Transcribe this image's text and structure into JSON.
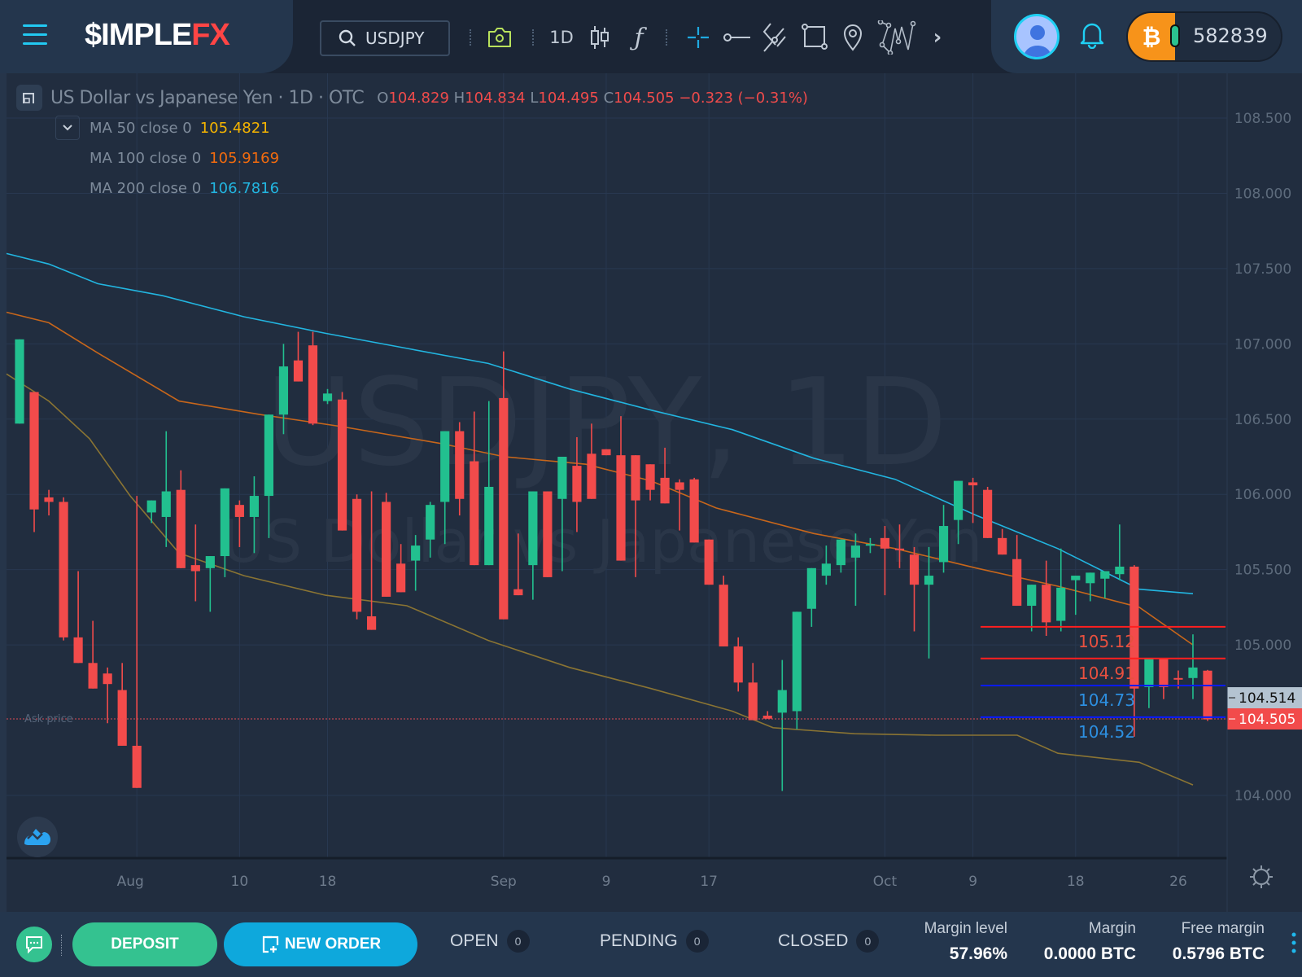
{
  "topbar": {
    "logo_prefix": "$IMPLE",
    "logo_suffix": "FX",
    "search_value": "USDJPY",
    "timeframe": "1D",
    "icons": [
      "menu-icon",
      "search-icon",
      "camera-icon",
      "candles-icon",
      "function-icon",
      "crosshair-icon",
      "horizontal-line-icon",
      "trend-lines-icon",
      "rectangle-icon",
      "location-pin-icon",
      "pattern-icon",
      "chevron-right-icon"
    ],
    "balance": "582839",
    "currency": "BTC"
  },
  "legend": {
    "title": "US Dollar vs Japanese Yen · 1D · OTC",
    "o_label": "O",
    "o": "104.829",
    "h_label": "H",
    "h": "104.834",
    "l_label": "L",
    "l": "104.495",
    "c_label": "C",
    "c": "104.505",
    "change": "−0.323 (−0.31%)",
    "ma": [
      {
        "label": "MA 50 close 0",
        "value": "105.4821",
        "color": "#f5b400"
      },
      {
        "label": "MA 100 close 0",
        "value": "105.9169",
        "color": "#f26b0e"
      },
      {
        "label": "MA 200 close 0",
        "value": "106.7816",
        "color": "#22b5e0"
      }
    ]
  },
  "watermark": {
    "symbol": "USDJPY, 1D",
    "name": "US Dollar vs Japanese Yen"
  },
  "chart_data": {
    "type": "candlestick",
    "title": "US Dollar vs Japanese Yen · 1D · OTC",
    "ylim": [
      103.6,
      108.72
    ],
    "y_ticks": [
      "108.500",
      "108.000",
      "107.500",
      "107.000",
      "106.500",
      "106.000",
      "105.500",
      "105.000",
      "104.000"
    ],
    "y_tick_values": [
      108.5,
      108.0,
      107.5,
      107.0,
      106.5,
      106.0,
      105.5,
      105.0,
      104.0
    ],
    "x_ticks": [
      {
        "label": "Aug",
        "index": 8
      },
      {
        "label": "10",
        "index": 15
      },
      {
        "label": "18",
        "index": 21
      },
      {
        "label": "Sep",
        "index": 33
      },
      {
        "label": "9",
        "index": 40
      },
      {
        "label": "17",
        "index": 47
      },
      {
        "label": "Oct",
        "index": 59
      },
      {
        "label": "9",
        "index": 65
      },
      {
        "label": "18",
        "index": 72
      },
      {
        "label": "26",
        "index": 79
      }
    ],
    "candles": [
      [
        106.47,
        107.03,
        106.47,
        107.03
      ],
      [
        106.68,
        106.68,
        105.75,
        105.9
      ],
      [
        105.98,
        106.03,
        105.86,
        105.95
      ],
      [
        105.95,
        105.98,
        105.03,
        105.05
      ],
      [
        105.05,
        105.49,
        104.96,
        104.88
      ],
      [
        104.88,
        105.16,
        104.73,
        104.71
      ],
      [
        104.81,
        104.85,
        104.48,
        104.74
      ],
      [
        104.7,
        104.88,
        104.39,
        104.33
      ],
      [
        104.33,
        105.99,
        104.35,
        104.05
      ],
      [
        105.88,
        105.93,
        105.81,
        105.96
      ],
      [
        105.85,
        106.42,
        105.65,
        106.02
      ],
      [
        106.03,
        106.16,
        105.53,
        105.51
      ],
      [
        105.53,
        105.8,
        105.29,
        105.49
      ],
      [
        105.51,
        105.51,
        105.22,
        105.59
      ],
      [
        105.59,
        105.95,
        105.45,
        106.04
      ],
      [
        105.93,
        105.96,
        105.65,
        105.85
      ],
      [
        105.85,
        106.12,
        105.61,
        105.99
      ],
      [
        105.99,
        106.35,
        105.71,
        106.53
      ],
      [
        106.53,
        107.0,
        106.4,
        106.85
      ],
      [
        106.89,
        107.08,
        106.82,
        106.75
      ],
      [
        106.99,
        107.08,
        106.46,
        106.47
      ],
      [
        106.62,
        106.7,
        106.6,
        106.67
      ],
      [
        106.63,
        106.68,
        105.82,
        105.76
      ],
      [
        105.97,
        106.0,
        105.17,
        105.22
      ],
      [
        105.19,
        106.02,
        105.17,
        105.1
      ],
      [
        105.95,
        106.01,
        105.51,
        105.32
      ],
      [
        105.54,
        105.67,
        105.51,
        105.35
      ],
      [
        105.56,
        105.73,
        105.36,
        105.66
      ],
      [
        105.7,
        105.95,
        105.58,
        105.93
      ],
      [
        105.95,
        106.42,
        105.67,
        106.42
      ],
      [
        106.42,
        106.48,
        105.86,
        105.97
      ],
      [
        106.22,
        106.55,
        105.83,
        105.53
      ],
      [
        105.53,
        106.62,
        105.54,
        106.05
      ],
      [
        106.64,
        106.95,
        105.25,
        105.17
      ],
      [
        105.37,
        105.74,
        105.35,
        105.33
      ],
      [
        105.53,
        106.01,
        105.3,
        106.02
      ],
      [
        106.02,
        105.95,
        105.83,
        105.45
      ],
      [
        105.97,
        106.22,
        105.49,
        106.25
      ],
      [
        106.19,
        106.38,
        105.75,
        105.95
      ],
      [
        106.27,
        106.47,
        105.98,
        105.97
      ],
      [
        106.3,
        106.29,
        106.27,
        106.26
      ],
      [
        106.26,
        106.52,
        105.97,
        105.56
      ],
      [
        106.26,
        106.23,
        105.45,
        105.96
      ],
      [
        106.2,
        106.19,
        105.96,
        106.03
      ],
      [
        106.11,
        106.31,
        105.97,
        105.94
      ],
      [
        106.08,
        106.1,
        105.76,
        106.03
      ],
      [
        106.1,
        106.11,
        105.72,
        105.68
      ],
      [
        105.7,
        105.66,
        105.41,
        105.4
      ],
      [
        105.4,
        105.46,
        105.01,
        104.99
      ],
      [
        104.99,
        105.05,
        104.69,
        104.75
      ],
      [
        104.75,
        104.88,
        104.62,
        104.5
      ],
      [
        104.53,
        104.56,
        104.53,
        104.51
      ],
      [
        104.55,
        104.9,
        104.03,
        104.7
      ],
      [
        104.56,
        105.08,
        104.44,
        105.22
      ],
      [
        105.24,
        105.48,
        105.12,
        105.51
      ],
      [
        105.46,
        105.66,
        105.4,
        105.54
      ],
      [
        105.53,
        105.66,
        105.48,
        105.7
      ],
      [
        105.58,
        105.74,
        105.26,
        105.66
      ],
      [
        105.66,
        105.71,
        105.61,
        105.67
      ],
      [
        105.71,
        105.79,
        105.33,
        105.64
      ],
      [
        105.64,
        105.8,
        105.51,
        105.63
      ],
      [
        105.6,
        105.65,
        105.09,
        105.4
      ],
      [
        105.4,
        105.65,
        104.91,
        105.46
      ],
      [
        105.55,
        105.93,
        105.48,
        105.79
      ],
      [
        105.83,
        106.01,
        105.67,
        106.09
      ],
      [
        106.08,
        106.11,
        105.81,
        106.06
      ],
      [
        106.03,
        106.05,
        105.81,
        105.71
      ],
      [
        105.71,
        105.77,
        105.6,
        105.6
      ],
      [
        105.57,
        105.73,
        105.4,
        105.26
      ],
      [
        105.26,
        105.4,
        105.09,
        105.4
      ],
      [
        105.4,
        105.56,
        105.06,
        105.15
      ],
      [
        105.16,
        105.64,
        105.09,
        105.38
      ],
      [
        105.43,
        105.44,
        105.2,
        105.46
      ],
      [
        105.41,
        105.42,
        105.29,
        105.48
      ],
      [
        105.44,
        105.45,
        105.31,
        105.49
      ],
      [
        105.47,
        105.8,
        105.43,
        105.52
      ],
      [
        105.52,
        105.53,
        104.39,
        104.71
      ],
      [
        104.72,
        104.87,
        104.58,
        104.91
      ],
      [
        104.91,
        104.91,
        104.64,
        104.72
      ],
      [
        104.78,
        104.83,
        104.71,
        104.77
      ],
      [
        104.78,
        105.07,
        104.64,
        104.85
      ],
      [
        104.829,
        104.834,
        104.495,
        104.505
      ]
    ],
    "ma_series": [
      {
        "name": "MA 200",
        "color": "#22b5e0",
        "last": 106.7816
      },
      {
        "name": "MA 100",
        "color": "#c7661b",
        "last": 105.9169
      },
      {
        "name": "MA 50",
        "color": "#8a7433",
        "last": 105.4821
      }
    ],
    "horizontal_lines": [
      {
        "value": 105.12,
        "label": "105.12",
        "color": "#ff1f1f",
        "label_color": "#e8503f"
      },
      {
        "value": 104.91,
        "label": "104.91",
        "color": "#ff1f1f",
        "label_color": "#e8503f"
      },
      {
        "value": 104.73,
        "label": "104.73",
        "color": "#0a1bff",
        "label_color": "#2d8fe0"
      },
      {
        "value": 104.52,
        "label": "104.52",
        "color": "#0a1bff",
        "label_color": "#2d8fe0"
      }
    ],
    "ask_price": {
      "label": "Ask price",
      "value": 104.514
    },
    "bid_price": {
      "value": 104.505
    },
    "price_tags": [
      {
        "label": "104.514",
        "value": 104.514,
        "bg": "#b4c3d1",
        "fg": "#111"
      },
      {
        "label": "104.505",
        "value": 104.505,
        "bg": "#f24b4b",
        "fg": "#fff"
      }
    ],
    "colors": {
      "up": "#22c08f",
      "down": "#f24b4b",
      "grid": "#283850",
      "axis_text": "#5d6b7c"
    }
  },
  "bottombar": {
    "deposit_label": "DEPOSIT",
    "new_order_label": "NEW ORDER",
    "tabs": [
      {
        "label": "OPEN",
        "count": "0"
      },
      {
        "label": "PENDING",
        "count": "0"
      },
      {
        "label": "CLOSED",
        "count": "0"
      }
    ],
    "stats": [
      {
        "label": "Margin level",
        "value": "57.96%"
      },
      {
        "label": "Margin",
        "value": "0.0000 BTC"
      },
      {
        "label": "Free margin",
        "value": "0.5796 BTC"
      }
    ]
  }
}
